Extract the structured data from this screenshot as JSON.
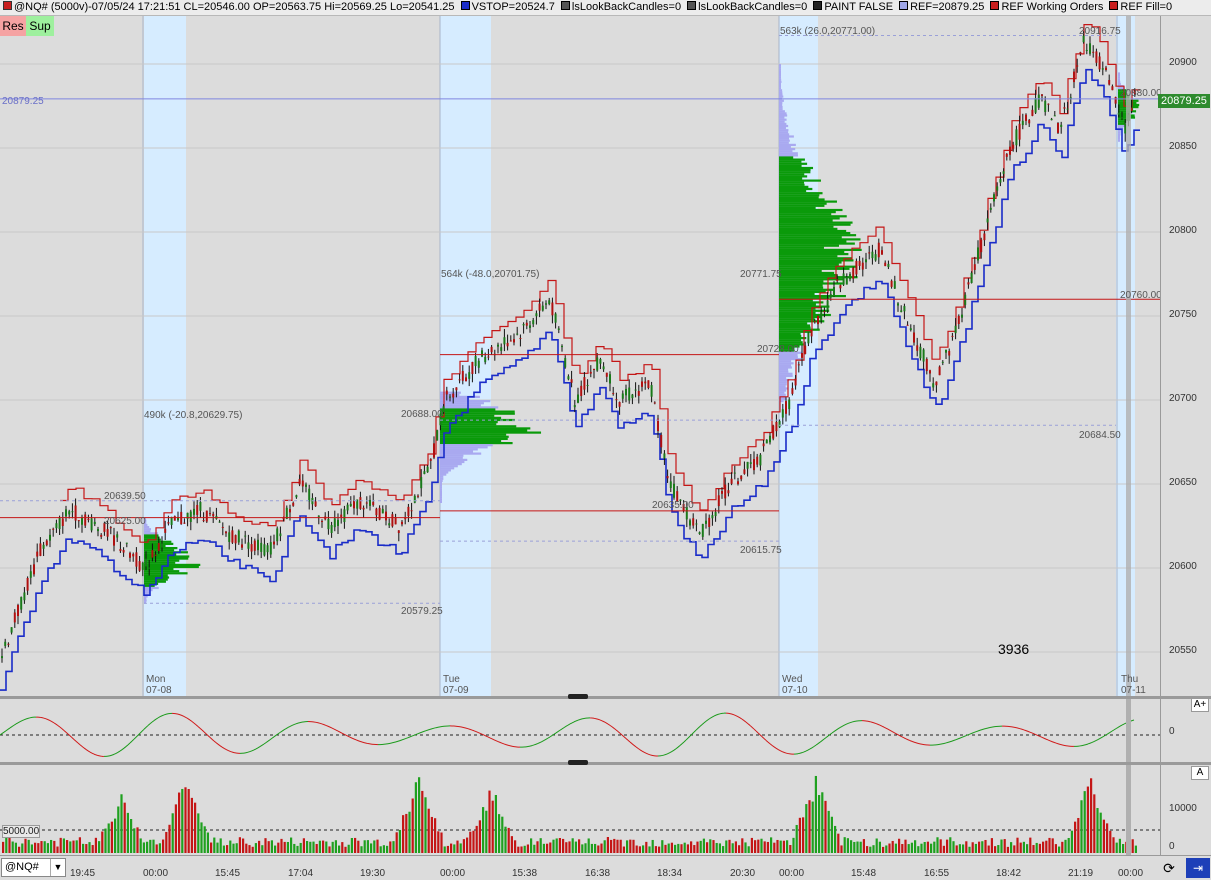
{
  "header": {
    "symbol_info": "@NQ# (5000v)-07/05/24 17:21:51 CL=20546.00 OP=20563.75 Hi=20569.25 Lo=20541.25",
    "items": [
      {
        "label": "VSTOP=20524.7",
        "color": "#1a2cc8"
      },
      {
        "label": "lsLookBackCandles=0",
        "color": "#555555"
      },
      {
        "label": "lsLookBackCandles=0",
        "color": "#555555"
      },
      {
        "label": "PAINT FALSE",
        "color": "#222222"
      },
      {
        "label": "REF=20879.25",
        "color": "#9fa6e8"
      },
      {
        "label": "REF Working Orders",
        "color": "#c81e1e"
      },
      {
        "label": "REF Fill=0",
        "color": "#c81e1e"
      }
    ]
  },
  "buttons": {
    "res": "Res",
    "sup": "Sup"
  },
  "colors": {
    "up": "#1fa01f",
    "down": "#c41616",
    "vstop": "#1a2cc8",
    "ref": "#7f86e0",
    "profile_va": "#0a9a0a",
    "profile_out": "#a9a9f0",
    "session": "#d6ecff"
  },
  "price_axis": {
    "labels": [
      "20900",
      "20850",
      "20800",
      "20750",
      "20700",
      "20650",
      "20600",
      "20550"
    ],
    "current": "20879.25",
    "ref_label": "20879.25"
  },
  "osc_axis": {
    "zero": "0",
    "aplus": "A+"
  },
  "vol_axis": {
    "labels": [
      "10000",
      "0"
    ],
    "ref_label": "5000.00",
    "aplus": "A"
  },
  "time_labels": [
    "19:45",
    "00:00",
    "15:45",
    "17:04",
    "19:30",
    "00:00",
    "15:38",
    "16:38",
    "18:34",
    "20:30",
    "00:00",
    "15:48",
    "16:55",
    "18:42",
    "21:19",
    "00:00"
  ],
  "days": [
    {
      "day": "Mon",
      "date": "07-08"
    },
    {
      "day": "Tue",
      "date": "07-09"
    },
    {
      "day": "Wed",
      "date": "07-10"
    },
    {
      "day": "Thu",
      "date": "07-11"
    }
  ],
  "profiles": {
    "mon": {
      "title": "490k (-20.8,20629.75)",
      "high": "20639.50",
      "low": "20579.25",
      "poc": "20625.00"
    },
    "tue": {
      "title": "564k (-48.0,20701.75)",
      "high": "20688.00",
      "low": "20635.00"
    },
    "wed": {
      "title": "563k (26.0,20771.00)",
      "high": "20771.75",
      "mid": "20728.00",
      "low": "20615.75"
    },
    "thu": {
      "high": "20916.75",
      "mid": "20880.00",
      "low": "20760.00",
      "far": "20684.50"
    }
  },
  "counter": "3936",
  "symbol": "@NQ#"
}
